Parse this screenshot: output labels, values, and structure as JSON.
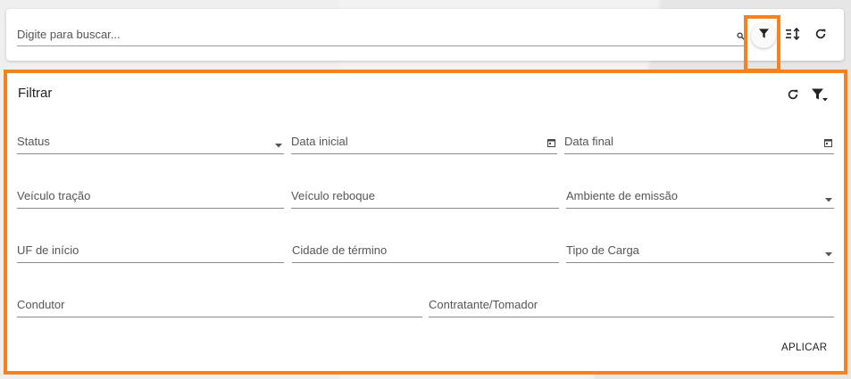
{
  "search": {
    "placeholder": "Digite para buscar..."
  },
  "toolbar": {
    "icons": [
      "search-icon",
      "filter-icon",
      "sort-icon",
      "refresh-icon"
    ]
  },
  "filter_panel": {
    "title": "Filtrar",
    "fields": {
      "status": "Status",
      "data_inicial": "Data inicial",
      "data_final": "Data final",
      "veiculo_tracao": "Veículo tração",
      "veiculo_reboque": "Veículo reboque",
      "ambiente_emissao": "Ambiente de emissão",
      "uf_inicio": "UF de início",
      "cidade_termino": "Cidade de término",
      "tipo_carga": "Tipo de Carga",
      "condutor": "Condutor",
      "contratante": "Contratante/Tomador"
    },
    "apply_label": "APLICAR"
  },
  "colors": {
    "highlight": "#f5821f",
    "background": "#efefef"
  }
}
